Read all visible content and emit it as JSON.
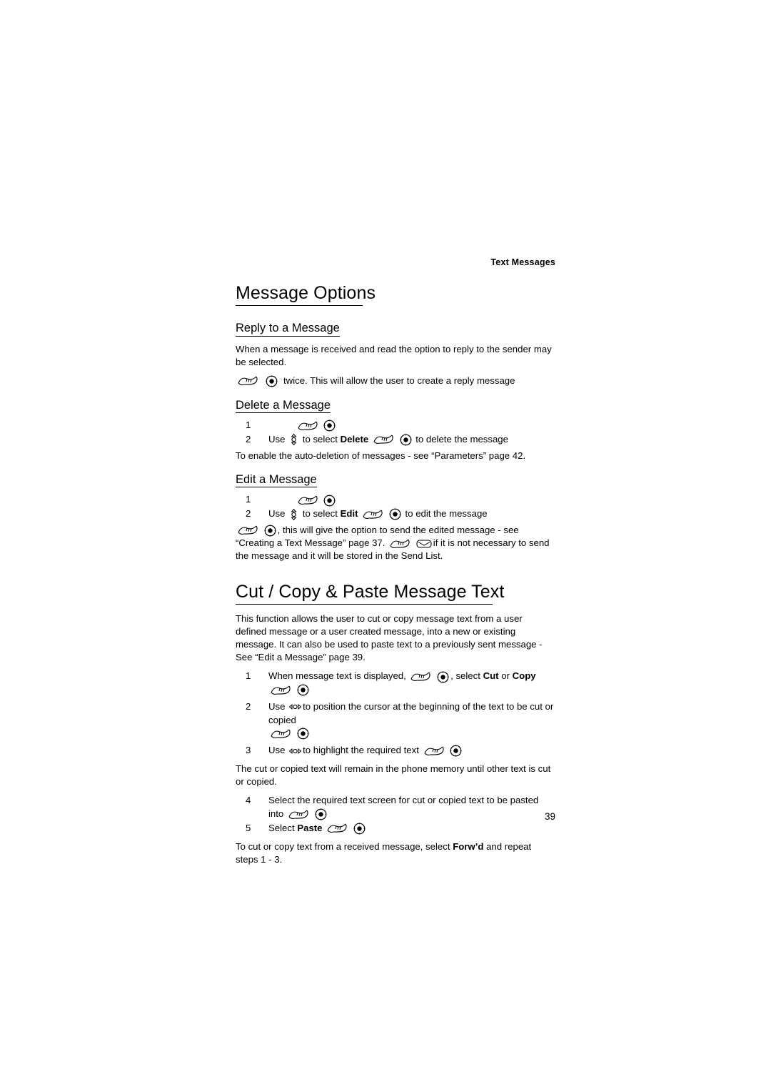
{
  "header": {
    "running_head": "Text Messages"
  },
  "page_number": "39",
  "sections": {
    "message_options": {
      "title": "Message Options",
      "reply": {
        "heading": "Reply to a Message",
        "intro": "When a message is received and read the option to reply to the sender may be selected.",
        "line": "twice. This will allow the user to create a reply message"
      },
      "delete": {
        "heading": "Delete a Message",
        "step1_num": "1",
        "step2_num": "2",
        "step2_a": "Use",
        "step2_b": "to select",
        "step2_bold": "Delete",
        "step2_c": "to delete the message",
        "note": "To enable the auto-deletion of messages - see “Parameters” page 42."
      },
      "edit": {
        "heading": "Edit a Message",
        "step1_num": "1",
        "step2_num": "2",
        "step2_a": "Use",
        "step2_b": "to select",
        "step2_bold": "Edit",
        "step2_c": "to edit the message",
        "para_a": ",  this will give the option to send the edited message - see “Creating a Text Message” page 37.",
        "para_b": "if it is not necessary to send the message and it will be stored in the Send List."
      }
    },
    "cut_copy_paste": {
      "title": "Cut / Copy & Paste Message Text",
      "intro": "This function allows the user to cut or copy message text from a user defined message or a user created message, into a new or existing message. It can also be used to paste text to a previously sent message - See “Edit a Message” page 39.",
      "steps": [
        {
          "num": "1",
          "a": "When message text is displayed,",
          "b": ", select",
          "bold1": "Cut",
          "c": "or",
          "bold2": "Copy"
        },
        {
          "num": "2",
          "a": "Use",
          "b": "to position the cursor at the beginning of the text to be cut or copied"
        },
        {
          "num": "3",
          "a": "Use",
          "b": "to highlight the required text"
        }
      ],
      "note1": "The cut or copied text will remain in the phone memory until other text is cut or copied.",
      "step4": {
        "num": "4",
        "a": "Select the required text screen for cut or copied text to be pasted into"
      },
      "step5": {
        "num": "5",
        "a": "Select",
        "bold": "Paste"
      },
      "note2_a": "To cut or copy text from a received message, select",
      "note2_bold": "Forw’d",
      "note2_b": "and repeat steps 1 - 3."
    }
  },
  "icons": {
    "softkey": "softkey-icon",
    "ok": "ok-button-icon",
    "nav_vertical": "navigation-key-vertical-icon",
    "nav_horizontal": "navigation-key-horizontal-icon",
    "envelope": "envelope-icon"
  }
}
